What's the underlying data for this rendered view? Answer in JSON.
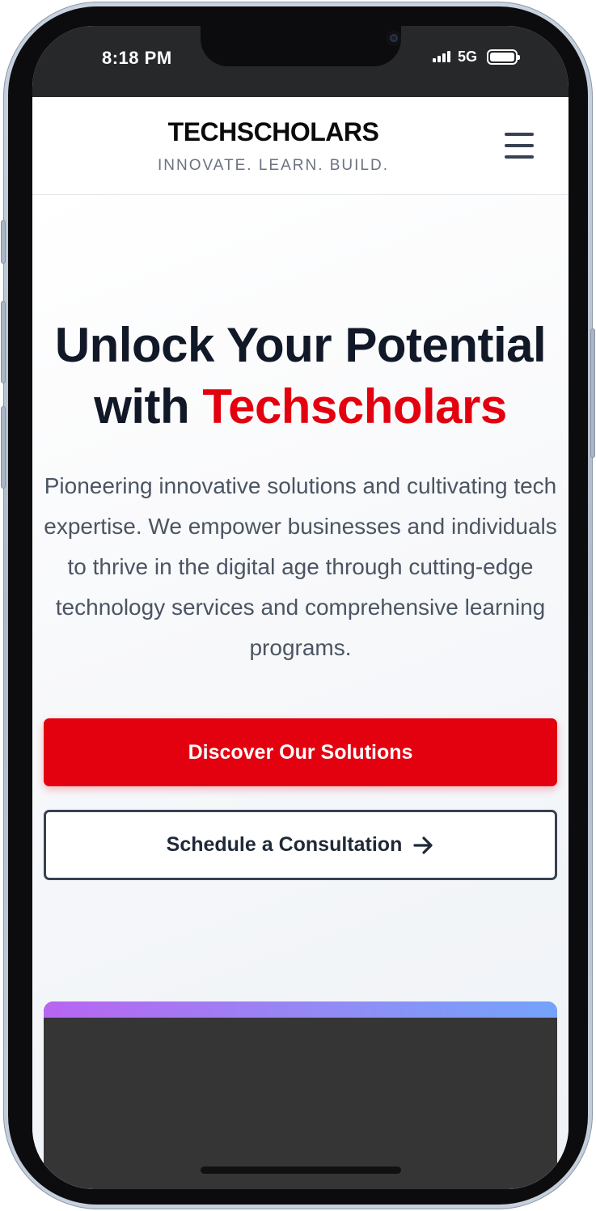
{
  "status_bar": {
    "time": "8:18 PM",
    "network": "5G",
    "signal_icon": "cellular-signal-icon",
    "battery_icon": "battery-full-icon"
  },
  "header": {
    "brand_name": "TECHSCHOLARS",
    "tagline": "INNOVATE. LEARN. BUILD.",
    "menu_icon": "hamburger-menu-icon"
  },
  "hero": {
    "title_line1": "Unlock Your Potential",
    "title_line2_prefix": "with",
    "title_line2_accent": "Techscholars",
    "description": "Pioneering innovative solutions and cultivating tech expertise. We empower businesses and individuals to thrive in the digital age through cutting-edge technology services and comprehensive learning programs.",
    "primary_cta": "Discover Our Solutions",
    "secondary_cta": "Schedule a Consultation",
    "secondary_cta_icon": "arrow-right-icon"
  },
  "colors": {
    "accent": "#e3000f",
    "heading": "#111827",
    "body_text": "#4b5563",
    "outline": "#374151",
    "gradient_start": "#b865f2",
    "gradient_end": "#74a3fb"
  }
}
